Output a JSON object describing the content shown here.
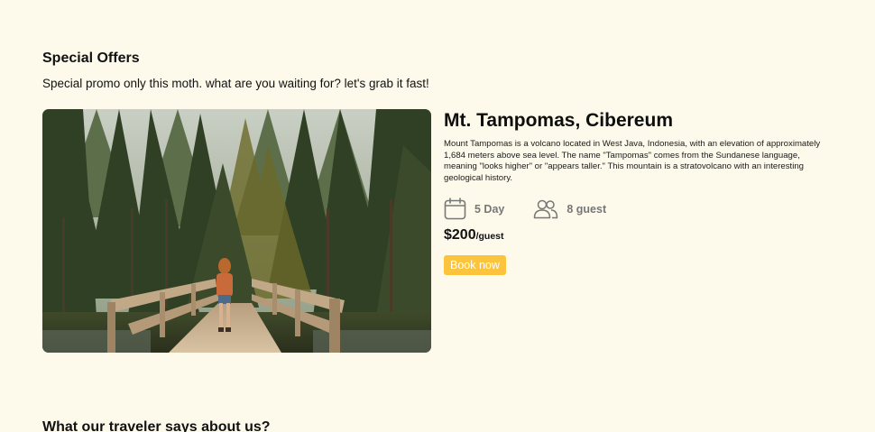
{
  "special_offers": {
    "title": "Special Offers",
    "subtitle": "Special promo only this moth. what are you waiting for? let's grab it fast!"
  },
  "offer": {
    "image_icon": "forest-bridge-hiker-photo",
    "name": "Mt. Tampomas, Cibereum",
    "description": "Mount Tampomas is a volcano located in West Java, Indonesia, with an elevation of approximately 1,684 meters above sea level. The name \"Tampomas\" comes from the Sundanese language, meaning \"looks higher\" or \"appears taller.\" This mountain is a stratovolcano with an interesting geological history.",
    "duration": "5 Day",
    "duration_icon": "calendar-icon",
    "guests": "8 guest",
    "guests_icon": "users-icon",
    "price": "$200",
    "price_unit": "/guest",
    "book_label": "Book now"
  },
  "testimonials": {
    "title": "What our traveler says about us?"
  },
  "colors": {
    "background": "#fefaeb",
    "accent": "#fbc43c",
    "muted_text": "#777777"
  }
}
